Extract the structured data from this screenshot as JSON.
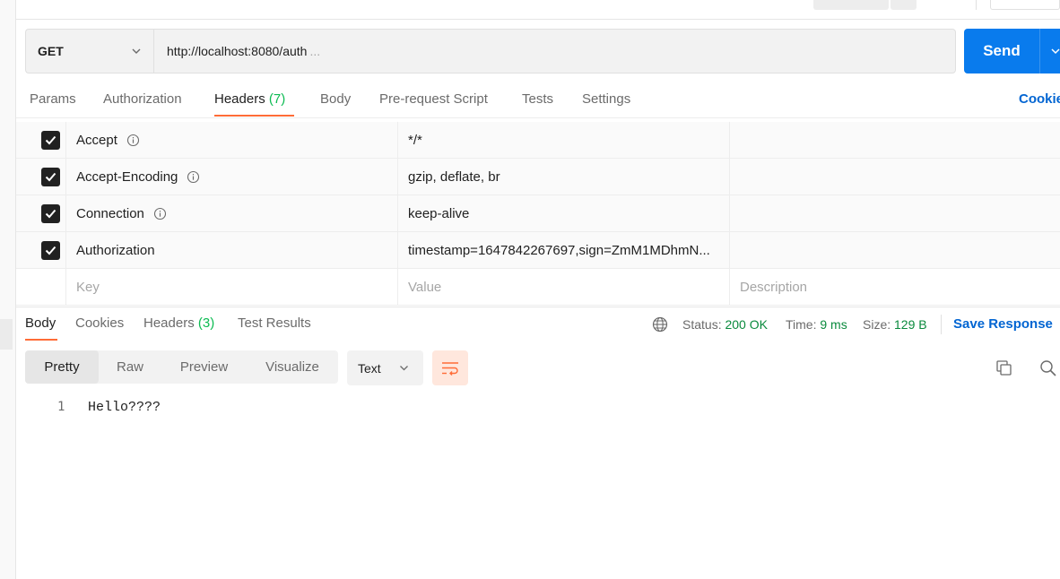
{
  "request": {
    "method": "GET",
    "url": "http://localhost:8080/auth",
    "url_ellipsis": "...",
    "send_label": "Send"
  },
  "request_tabs": [
    {
      "label": "Params"
    },
    {
      "label": "Authorization"
    },
    {
      "label": "Headers",
      "count": "(7)"
    },
    {
      "label": "Body"
    },
    {
      "label": "Pre-request Script"
    },
    {
      "label": "Tests"
    },
    {
      "label": "Settings"
    }
  ],
  "cookies_link": "Cookie",
  "headers": [
    {
      "key": "Accept",
      "value": "*/*",
      "description": "",
      "checked": true,
      "info": true
    },
    {
      "key": "Accept-Encoding",
      "value": "gzip, deflate, br",
      "description": "",
      "checked": true,
      "info": true
    },
    {
      "key": "Connection",
      "value": "keep-alive",
      "description": "",
      "checked": true,
      "info": true
    },
    {
      "key": "Authorization",
      "value": "timestamp=1647842267697,sign=ZmM1MDhmN...",
      "description": "",
      "checked": true,
      "info": false
    }
  ],
  "header_placeholders": {
    "key": "Key",
    "value": "Value",
    "description": "Description"
  },
  "response_tabs": [
    {
      "label": "Body"
    },
    {
      "label": "Cookies"
    },
    {
      "label": "Headers",
      "count": "(3)"
    },
    {
      "label": "Test Results"
    }
  ],
  "response_stats": {
    "status_label": "Status:",
    "status_value": "200 OK",
    "time_label": "Time:",
    "time_value": "9 ms",
    "size_label": "Size:",
    "size_value": "129 B"
  },
  "save_response": "Save Response",
  "view_modes": [
    "Pretty",
    "Raw",
    "Preview",
    "Visualize"
  ],
  "language": "Text",
  "response_body": [
    {
      "line": "1",
      "text": "Hello????"
    }
  ],
  "colors": {
    "send": "#097bed",
    "accent": "#ff6c37",
    "success": "#0cbb52",
    "link": "#0265d2"
  }
}
